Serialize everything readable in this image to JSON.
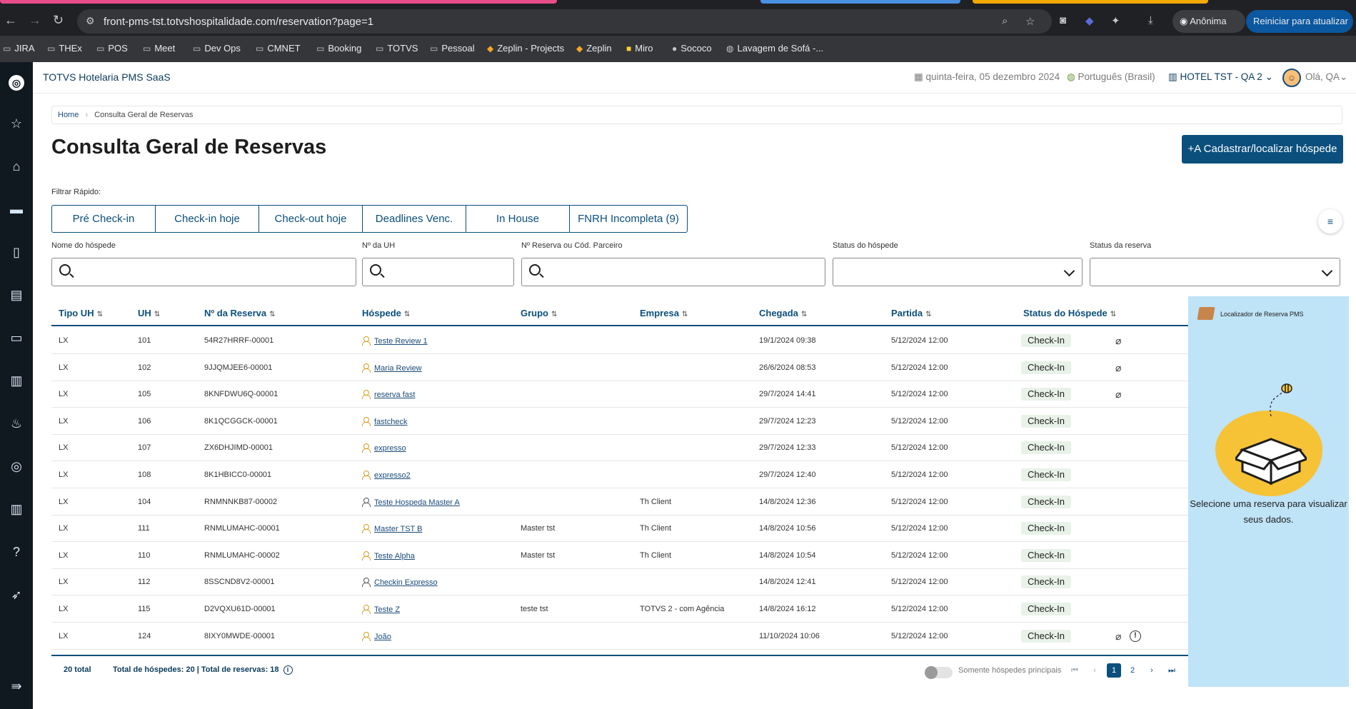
{
  "browser": {
    "url": "front-pms-tst.totvshospitalidade.com/reservation?page=1",
    "incognito_label": "Anônima",
    "restart_label": "Reiniciar para atualizar",
    "bookmarks": [
      "JIRA",
      "THEx",
      "POS",
      "Meet",
      "Dev Ops",
      "CMNET",
      "Booking",
      "TOTVS",
      "Pessoal",
      "Zeplin - Projects",
      "Zeplin",
      "Miro",
      "Sococo",
      "Lavagem de Sofá -..."
    ]
  },
  "header": {
    "app_title": "TOTVS Hotelaria PMS SaaS",
    "date": "quinta-feira, 05 dezembro 2024",
    "language": "Português (Brasil)",
    "hotel": "HOTEL TST - QA 2",
    "greeting": "Olá, QA"
  },
  "breadcrumb": {
    "home": "Home",
    "current": "Consulta Geral de Reservas"
  },
  "page_title": "Consulta Geral de Reservas",
  "primary_button": "Cadastrar/localizar hóspede",
  "quick_filter": {
    "label": "Filtrar Rápido:",
    "tabs": [
      "Pré Check-in",
      "Check-in hoje",
      "Check-out hoje",
      "Deadlines Venc.",
      "In House",
      "FNRH Incompleta (9)"
    ]
  },
  "filters": {
    "guest_name": "Nome do hóspede",
    "room_number": "Nº da UH",
    "reservation_number": "Nº Reserva ou Cód. Parceiro",
    "guest_status": "Status do hóspede",
    "reservation_status": "Status da reserva"
  },
  "table": {
    "columns": [
      "Tipo UH",
      "UH",
      "Nº da Reserva",
      "Hóspede",
      "Grupo",
      "Empresa",
      "Chegada",
      "Partida",
      "Status do Hóspede"
    ],
    "rows": [
      {
        "type": "LX",
        "uh": "101",
        "reserva": "54R27HRRF-00001",
        "hospede": "Teste Review 1",
        "grupo": "",
        "empresa": "",
        "chegada": "19/1/2024 09:38",
        "partida": "5/12/2024 12:00",
        "status": "Check-In",
        "clip": true,
        "info": false,
        "gold": true
      },
      {
        "type": "LX",
        "uh": "102",
        "reserva": "9JJQMJEE6-00001",
        "hospede": "Maria Review",
        "grupo": "",
        "empresa": "",
        "chegada": "26/6/2024 08:53",
        "partida": "5/12/2024 12:00",
        "status": "Check-In",
        "clip": true,
        "info": false,
        "gold": true
      },
      {
        "type": "LX",
        "uh": "105",
        "reserva": "8KNFDWU6Q-00001",
        "hospede": "reserva fast",
        "grupo": "",
        "empresa": "",
        "chegada": "29/7/2024 14:41",
        "partida": "5/12/2024 12:00",
        "status": "Check-In",
        "clip": true,
        "info": false,
        "gold": true
      },
      {
        "type": "LX",
        "uh": "106",
        "reserva": "8K1QCGGCK-00001",
        "hospede": "fastcheck",
        "grupo": "",
        "empresa": "",
        "chegada": "29/7/2024 12:23",
        "partida": "5/12/2024 12:00",
        "status": "Check-In",
        "clip": false,
        "info": false,
        "gold": true
      },
      {
        "type": "LX",
        "uh": "107",
        "reserva": "ZX6DHJIMD-00001",
        "hospede": "expresso",
        "grupo": "",
        "empresa": "",
        "chegada": "29/7/2024 12:33",
        "partida": "5/12/2024 12:00",
        "status": "Check-In",
        "clip": false,
        "info": false,
        "gold": true
      },
      {
        "type": "LX",
        "uh": "108",
        "reserva": "8K1HBICC0-00001",
        "hospede": "expresso2",
        "grupo": "",
        "empresa": "",
        "chegada": "29/7/2024 12:40",
        "partida": "5/12/2024 12:00",
        "status": "Check-In",
        "clip": false,
        "info": false,
        "gold": true
      },
      {
        "type": "LX",
        "uh": "104",
        "reserva": "RNMNNKB87-00002",
        "hospede": "Teste Hospeda Master A",
        "grupo": "",
        "empresa": "Th Client",
        "chegada": "14/8/2024 12:36",
        "partida": "5/12/2024 12:00",
        "status": "Check-In",
        "clip": false,
        "info": false,
        "gold": false
      },
      {
        "type": "LX",
        "uh": "111",
        "reserva": "RNMLUMAHC-00001",
        "hospede": "Master TST B",
        "grupo": "Master tst",
        "empresa": "Th Client",
        "chegada": "14/8/2024 10:56",
        "partida": "5/12/2024 12:00",
        "status": "Check-In",
        "clip": false,
        "info": false,
        "gold": true
      },
      {
        "type": "LX",
        "uh": "110",
        "reserva": "RNMLUMAHC-00002",
        "hospede": "Teste Alpha",
        "grupo": "Master tst",
        "empresa": "Th Client",
        "chegada": "14/8/2024 10:54",
        "partida": "5/12/2024 12:00",
        "status": "Check-In",
        "clip": false,
        "info": false,
        "gold": true
      },
      {
        "type": "LX",
        "uh": "112",
        "reserva": "8SSCND8V2-00001",
        "hospede": "Checkin Expresso",
        "grupo": "",
        "empresa": "",
        "chegada": "14/8/2024 12:41",
        "partida": "5/12/2024 12:00",
        "status": "Check-In",
        "clip": false,
        "info": false,
        "gold": false
      },
      {
        "type": "LX",
        "uh": "115",
        "reserva": "D2VQXU61D-00001",
        "hospede": "Teste Z",
        "grupo": "teste tst",
        "empresa": "TOTVS 2 - com Agência",
        "chegada": "14/8/2024 16:12",
        "partida": "5/12/2024 12:00",
        "status": "Check-In",
        "clip": false,
        "info": false,
        "gold": true
      },
      {
        "type": "LX",
        "uh": "124",
        "reserva": "8IXY0MWDE-00001",
        "hospede": "João",
        "grupo": "",
        "empresa": "",
        "chegada": "11/10/2024 10:06",
        "partida": "5/12/2024 12:00",
        "status": "Check-In",
        "clip": true,
        "info": true,
        "gold": true
      }
    ]
  },
  "footer": {
    "total": "20 total",
    "summary": "Total de hóspedes: 20 | Total de reservas: 18",
    "toggle_label": "Somente hóspedes principais",
    "pages": [
      "1",
      "2"
    ]
  },
  "right_panel": {
    "title": "Localizador de Reserva PMS",
    "message": "Selecione uma reserva para visualizar seus dados."
  }
}
